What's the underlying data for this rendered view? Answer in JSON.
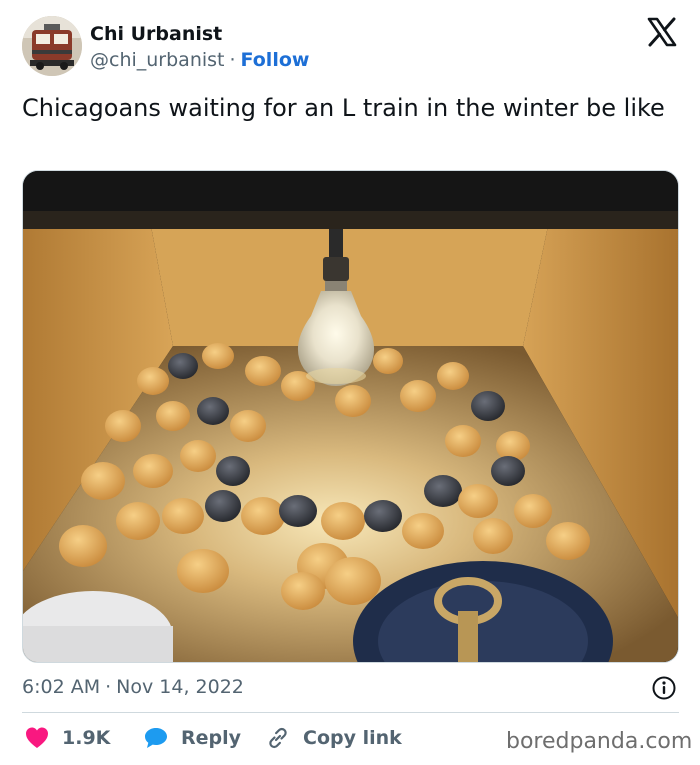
{
  "author": {
    "name": "Chi Urbanist",
    "handle": "@chi_urbanist",
    "separator": "·",
    "follow_label": "Follow",
    "avatar_icon": "train-avatar-icon"
  },
  "platform_icon": "x-logo-icon",
  "tweet": {
    "text": "Chicagoans waiting for an L train in the winter be like"
  },
  "media": {
    "image_icon": "chicks-under-heat-lamp-photo"
  },
  "meta": {
    "time": "6:02 AM",
    "separator": "·",
    "date": "Nov 14, 2022",
    "info_icon": "info-icon"
  },
  "actions": {
    "likes_count": "1.9K",
    "reply_label": "Reply",
    "copy_label": "Copy link"
  },
  "watermark": "boredpanda.com",
  "colors": {
    "like_red": "#f91880",
    "reply_blue": "#1d9bf0",
    "follow_blue": "#1d6fd6",
    "muted": "#536471"
  }
}
